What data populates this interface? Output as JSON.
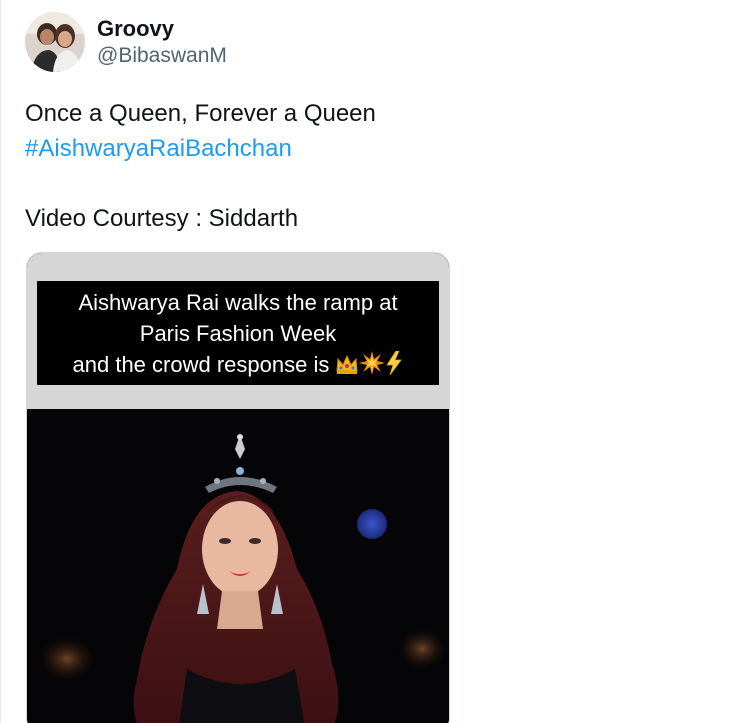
{
  "author": {
    "display_name": "Groovy",
    "handle": "@BibaswanM",
    "avatar_icon": "profile-photo-avatar"
  },
  "tweet": {
    "line1": "Once a Queen, Forever a Queen",
    "hashtag": "#AishwaryaRaiBachchan",
    "line3": "Video Courtesy : Siddarth"
  },
  "media": {
    "caption_line1": "Aishwarya Rai walks the ramp at",
    "caption_line2": "Paris Fashion Week",
    "caption_line3": "and the crowd response is",
    "caption_emojis": [
      "crown-emoji",
      "collision-emoji",
      "lightning-emoji"
    ]
  },
  "colors": {
    "link": "#1d9bf0",
    "text": "#0f1419",
    "secondary": "#536471"
  }
}
